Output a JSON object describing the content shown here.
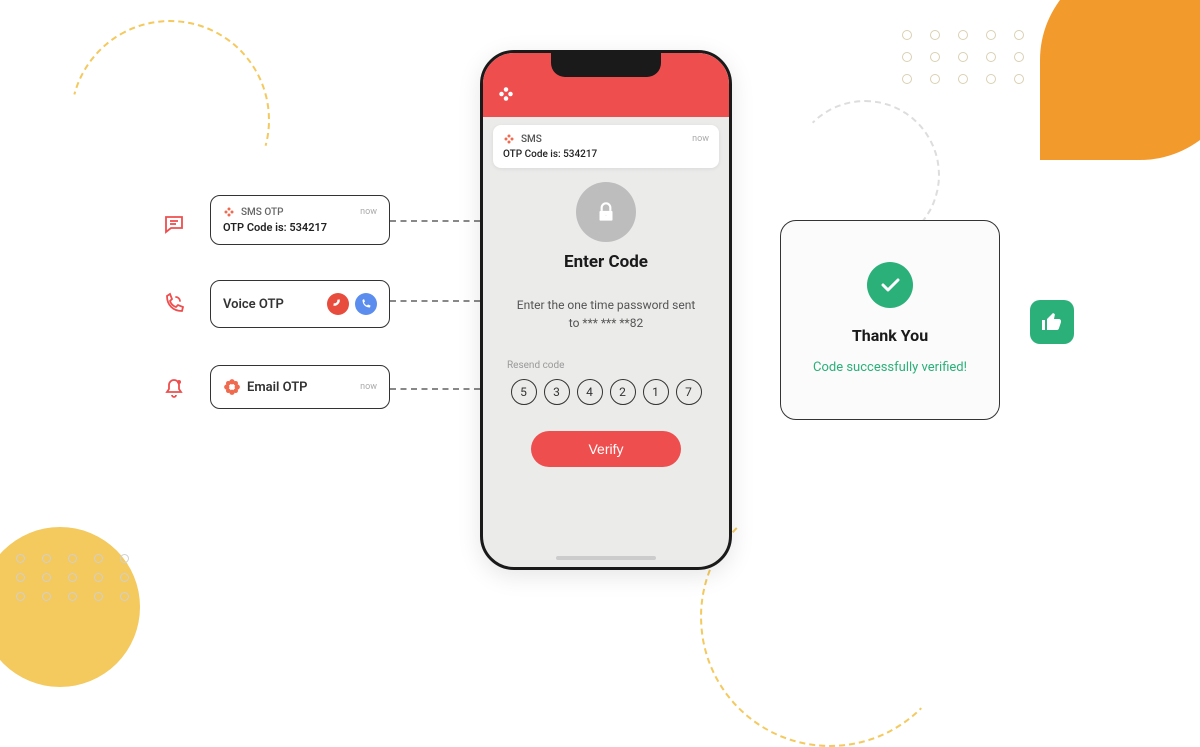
{
  "phone": {
    "notification": {
      "app": "SMS",
      "time": "now",
      "message": "OTP Code is: 534217"
    },
    "title": "Enter Code",
    "subtitle": "Enter the one time password sent to *** *** **82",
    "resend": "Resend code",
    "code": [
      "5",
      "3",
      "4",
      "2",
      "1",
      "7"
    ],
    "verify": "Verify"
  },
  "left": {
    "sms": {
      "label": "SMS OTP",
      "time": "now",
      "body": "OTP Code is: 534217"
    },
    "voice": {
      "title": "Voice OTP"
    },
    "email": {
      "title": "Email OTP",
      "time": "now"
    }
  },
  "right": {
    "title": "Thank You",
    "subtitle": "Code successfully verified!"
  }
}
